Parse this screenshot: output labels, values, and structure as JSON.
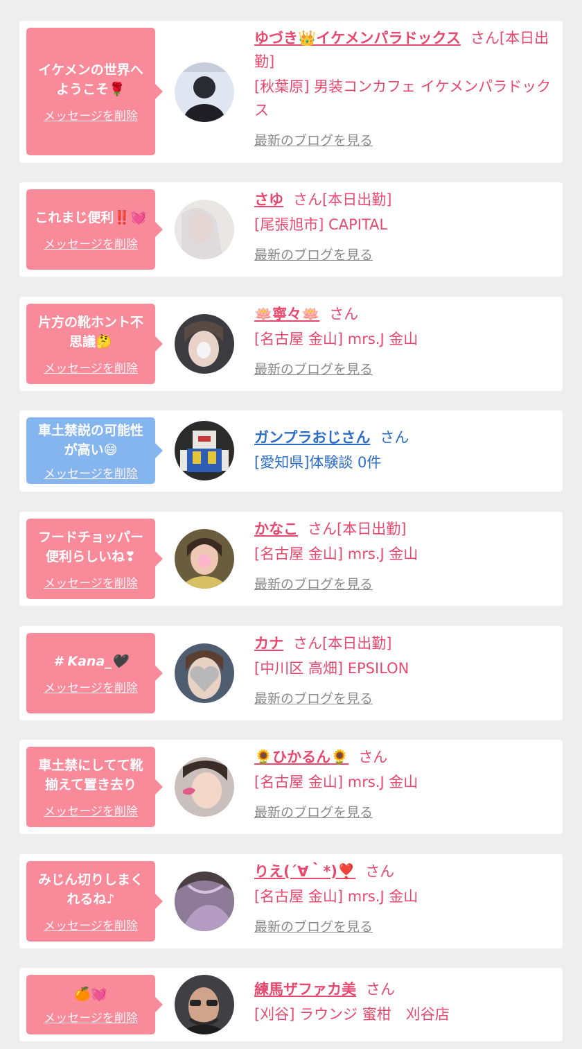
{
  "entries": [
    {
      "message": "イケメンの世界へようこそ🌹",
      "delete_label": "メッセージを削除",
      "name": "ゆづき👑イケメンパラドックス",
      "san_label": "さん[本日出勤]",
      "shop": "[秋葉原] 男装コンカフェ イケメンパラドックス",
      "blog_label": "最新のブログを見る",
      "bubble_color": "#f88a9a"
    },
    {
      "message": "これまじ便利‼️💓",
      "delete_label": "メッセージを削除",
      "name": "さゆ",
      "san_label": "さん[本日出勤]",
      "shop": "[尾張旭市] CAPITAL",
      "blog_label": "最新のブログを見る",
      "bubble_color": "#f88a9a"
    },
    {
      "message": "片方の靴ホント不思議🤔",
      "delete_label": "メッセージを削除",
      "name": "🪷寧々🪷",
      "san_label": "さん",
      "shop": "[名古屋 金山] mrs.J 金山",
      "blog_label": "最新のブログを見る",
      "bubble_color": "#f88a9a"
    },
    {
      "message": "車土禁説の可能性が高い😄",
      "delete_label": "メッセージを削除",
      "name": "ガンプラおじさん",
      "san_label": "さん",
      "shop": "[愛知県]体験談 0件",
      "bubble_color": "#85b5ee"
    },
    {
      "message": "フードチョッパー便利らしいね❣",
      "delete_label": "メッセージを削除",
      "name": "かなこ",
      "san_label": "さん[本日出勤]",
      "shop": "[名古屋 金山] mrs.J 金山",
      "blog_label": "最新のブログを見る",
      "bubble_color": "#f88a9a"
    },
    {
      "message": "# Kana_🖤",
      "delete_label": "メッセージを削除",
      "name": "カナ",
      "san_label": "さん[本日出勤]",
      "shop": "[中川区 高畑] EPSILON",
      "blog_label": "最新のブログを見る",
      "bubble_color": "#f88a9a"
    },
    {
      "message": "車土禁にしてて靴揃えて置き去り",
      "delete_label": "メッセージを削除",
      "name": "🌻ひかるん🌻",
      "san_label": "さん",
      "shop": "[名古屋 金山] mrs.J 金山",
      "blog_label": "最新のブログを見る",
      "bubble_color": "#f88a9a"
    },
    {
      "message": "みじん切りしまくれるね♪",
      "delete_label": "メッセージを削除",
      "name": "りえ(´∀｀*)❣️",
      "san_label": "さん",
      "shop": "[名古屋 金山] mrs.J 金山",
      "blog_label": "最新のブログを見る",
      "bubble_color": "#f88a9a"
    },
    {
      "message": "🍊💓",
      "delete_label": "メッセージを削除",
      "name": "練馬ザファカ美",
      "san_label": "さん",
      "shop": "[刈谷] ラウンジ 蜜柑　刈谷店",
      "bubble_color": "#f88a9a"
    }
  ]
}
